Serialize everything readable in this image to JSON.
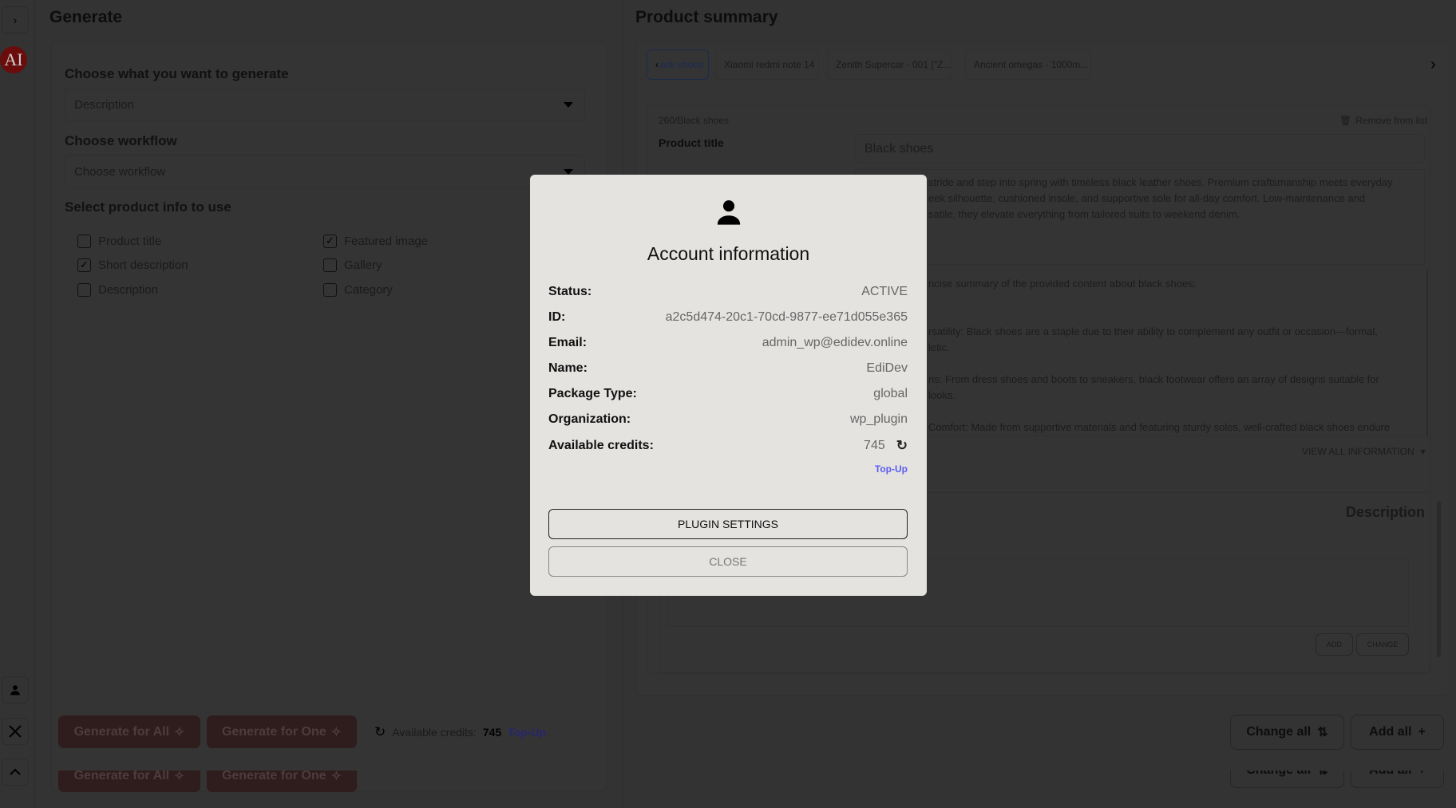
{
  "sidebar": {
    "expand_icon": "›",
    "logo_text": "AI"
  },
  "generate": {
    "title": "Generate",
    "what_label": "Choose what you want to generate",
    "what_value": "Description",
    "workflow_label": "Choose workflow",
    "workflow_placeholder": "Choose workflow",
    "info_label": "Select product info to use",
    "checkboxes": [
      {
        "label": "Product title",
        "checked": false
      },
      {
        "label": "Featured image",
        "checked": true
      },
      {
        "label": "Short description",
        "checked": true
      },
      {
        "label": "Gallery",
        "checked": false
      },
      {
        "label": "Description",
        "checked": false
      },
      {
        "label": "Category",
        "checked": false
      }
    ],
    "gen_all": "Generate for All",
    "gen_one": "Generate for One",
    "credits_label": "Available credits:",
    "credits_value": "745",
    "topup": "Top-Up"
  },
  "summary": {
    "title": "Product summary",
    "tabs": [
      "ack shoes",
      "Xiaomi redmi note 14",
      "Zenith Supercar - 001 [\"Z...",
      "Ancient omegas - 1000m..."
    ],
    "product_path": "260/Black shoes",
    "remove": "Remove from list",
    "product_title_label": "Product title",
    "product_title_value": "Black shoes",
    "short_desc_lines": [
      "stride and step into spring with timeless black leather shoes. Premium craftsmanship meets everyday",
      "eek silhouette, cushioned insole, and supportive sole for all-day comfort. Low-maintenance and",
      "satile, they elevate everything from tailored suits to weekend denim."
    ],
    "desc_lines": [
      "ncise summary of the provided content about black shoes:",
      "",
      "rsatility: Black shoes are a staple due to their ability to complement any outfit or occasion—formal,",
      "letic.",
      "ns: From dress shoes and boots to sneakers, black footwear offers an array of designs suitable for",
      "looks.",
      "Comfort: Made from supportive materials and featuring sturdy soles, well-crafted black shoes endure"
    ],
    "view_all": "VIEW ALL INFORMATION",
    "desc_section_label": "Description",
    "add": "ADD",
    "change": "CHANGE",
    "change_all": "Change all",
    "add_all": "Add all"
  },
  "modal": {
    "title": "Account information",
    "rows": [
      {
        "k": "Status:",
        "v": "ACTIVE"
      },
      {
        "k": "ID:",
        "v": "a2c5d474-20c1-70cd-9877-ee71d055e365"
      },
      {
        "k": "Email:",
        "v": "admin_wp@edidev.online"
      },
      {
        "k": "Name:",
        "v": "EdiDev"
      },
      {
        "k": "Package Type:",
        "v": "global"
      },
      {
        "k": "Organization:",
        "v": "wp_plugin"
      },
      {
        "k": "Available credits:",
        "v": "745"
      }
    ],
    "topup": "Top-Up",
    "plugin_settings": "PLUGIN SETTINGS",
    "close": "CLOSE"
  },
  "colors": {
    "accent_red": "#e88c8c",
    "link": "#5b5bf0",
    "modal_bg": "#e4e3e0"
  }
}
